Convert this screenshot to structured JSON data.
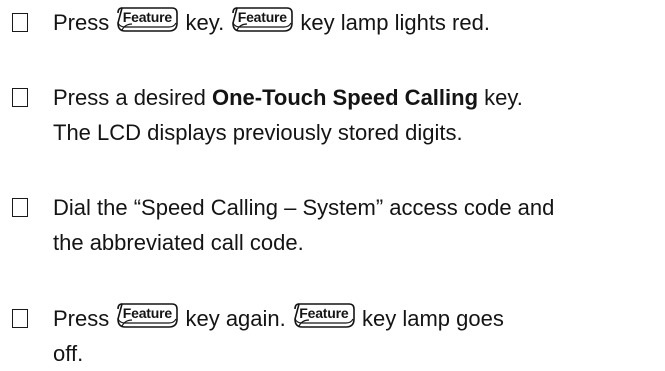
{
  "steps": [
    {
      "parts": [
        {
          "t": "Press "
        },
        {
          "key": "Feature"
        },
        {
          "t": " key. "
        },
        {
          "key": "Feature"
        },
        {
          "t": " key lamp lights red."
        }
      ]
    },
    {
      "lines": [
        {
          "parts": [
            {
              "t": "Press a desired "
            },
            {
              "b": "One-Touch Speed Calling"
            },
            {
              "t": " key."
            }
          ]
        },
        {
          "parts": [
            {
              "t": "The LCD displays previously stored digits."
            }
          ]
        }
      ]
    },
    {
      "lines": [
        {
          "parts": [
            {
              "t": "Dial the “Speed Calling – System” access code and"
            }
          ]
        },
        {
          "parts": [
            {
              "t": "the abbreviated call code."
            }
          ]
        }
      ]
    },
    {
      "lines": [
        {
          "parts": [
            {
              "t": "Press "
            },
            {
              "key": "Feature"
            },
            {
              "t": " key again. "
            },
            {
              "key": "Feature"
            },
            {
              "t": " key lamp goes"
            }
          ]
        },
        {
          "parts": [
            {
              "t": "off."
            }
          ]
        }
      ]
    }
  ]
}
